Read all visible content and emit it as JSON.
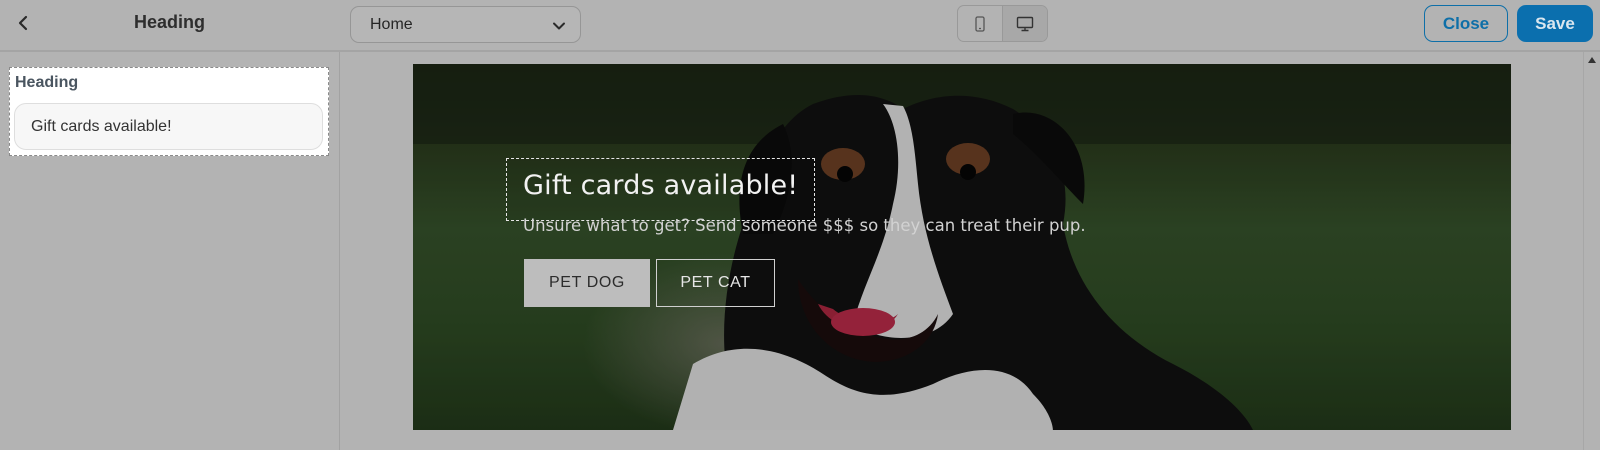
{
  "topbar": {
    "title": "Heading",
    "page_select": {
      "value": "Home"
    },
    "device_toggle": {
      "mobile_icon": "mobile-icon",
      "desktop_icon": "desktop-icon",
      "active": "desktop"
    },
    "close_label": "Close",
    "save_label": "Save",
    "colors": {
      "accent": "#0b6fae"
    }
  },
  "left_panel": {
    "section_label": "Heading",
    "heading_input_value": "Gift cards available!"
  },
  "preview": {
    "heading": "Gift cards available!",
    "subheading": "Unsure what to get? Send someone $$$ so they can treat their pup.",
    "buttons": [
      "PET DOG",
      "PET CAT"
    ],
    "background_image": "dog-photo"
  }
}
